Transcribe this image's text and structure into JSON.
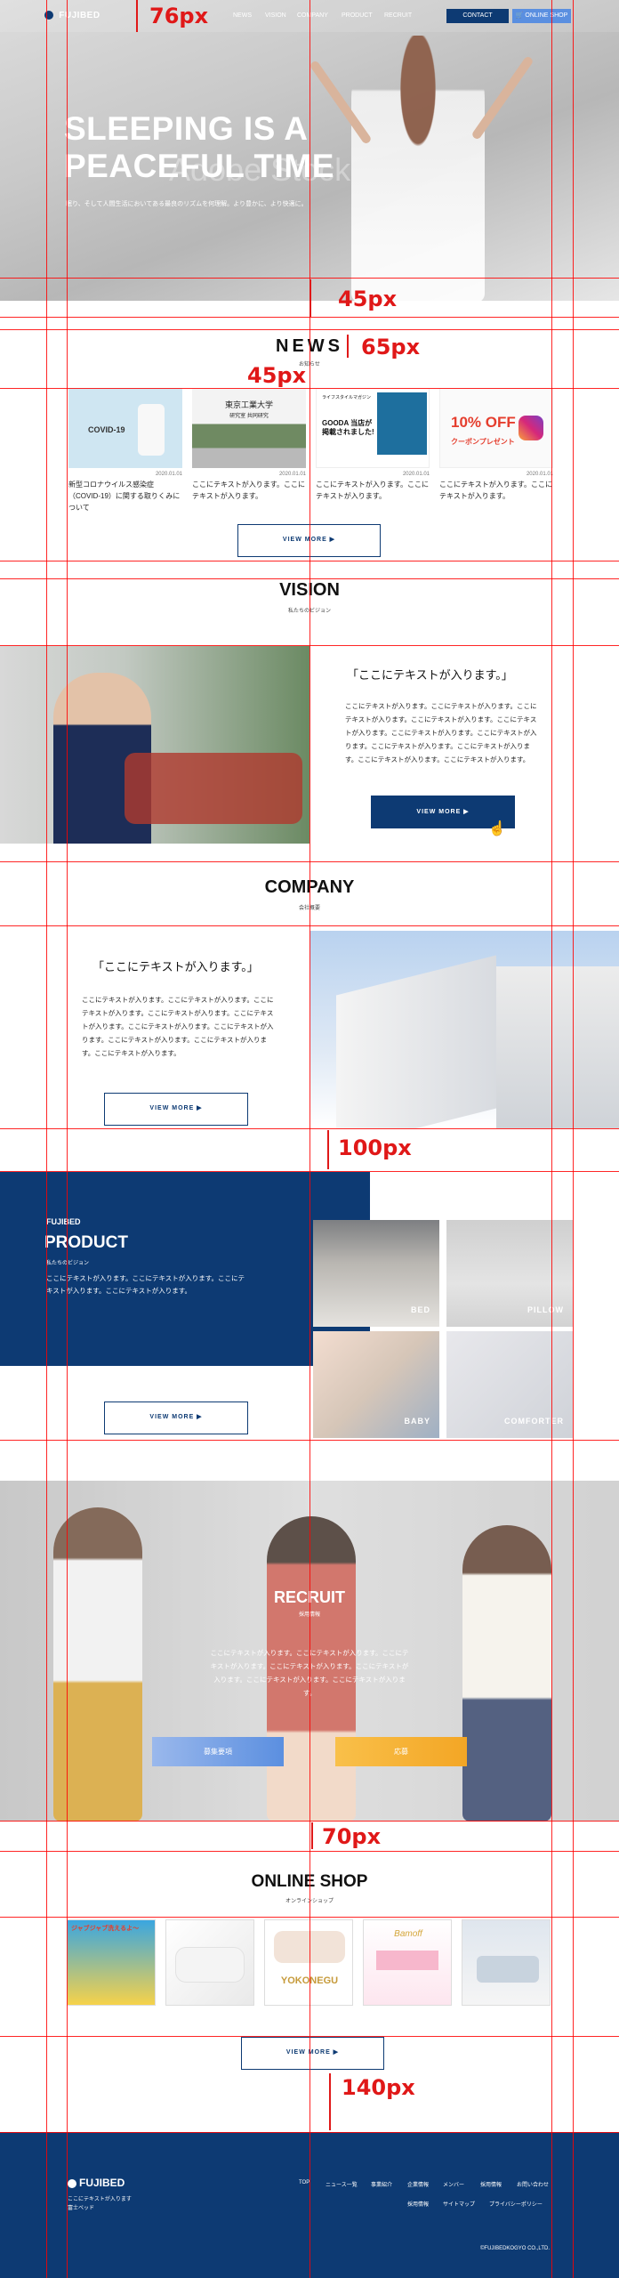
{
  "header": {
    "logo": "FUJIBED",
    "nav": [
      "NEWS",
      "VISION",
      "COMPANY",
      "PRODUCT",
      "RECRUIT"
    ],
    "contact_label": "CONTACT",
    "shop_label": "ONLINE SHOP"
  },
  "hero": {
    "title_line1": "SLEEPING IS A",
    "title_line2": "PEACEFUL TIME",
    "subtitle": "眠り、そして人間生活においてある最良のリズムを何理解。より豊かに、より快適に。",
    "watermark": "Adobe Stock"
  },
  "annotations": {
    "m76": "76px",
    "m45a": "45px",
    "m65": "65px",
    "m45b": "45px",
    "m100": "100px",
    "m70": "70px",
    "m140": "140px"
  },
  "news": {
    "title": "NEWS",
    "subtitle": "お知らせ",
    "cards": [
      {
        "img_text": "COVID-19",
        "date": "2020.01.01",
        "text": "新型コロナウイルス感染症（COVID-19）に関する取りくみについて"
      },
      {
        "img_text": "東京工業大学",
        "img_sub": "研究室 共同研究",
        "date": "2020.01.01",
        "text": "ここにテキストが入ります。ここにテキストが入ります。"
      },
      {
        "img_text": "ライフスタイルマガジン",
        "img_sub": "GOODA 当店が掲載されました!",
        "date": "2020.01.01",
        "text": "ここにテキストが入ります。ここにテキストが入ります。"
      },
      {
        "img_text": "10% OFF",
        "img_sub": "クーポンプレゼント",
        "date": "2020.01.01",
        "text": "ここにテキストが入ります。ここにテキストが入ります。"
      }
    ],
    "more": "VIEW MORE ▶"
  },
  "vision": {
    "title": "VISION",
    "subtitle": "私たちのビジョン",
    "quote": "「ここにテキストが入ります。」",
    "body": "ここにテキストが入ります。ここにテキストが入ります。ここにテキストが入ります。ここにテキストが入ります。ここにテキストが入ります。ここにテキストが入ります。ここにテキストが入ります。ここにテキストが入ります。ここにテキストが入ります。ここにテキストが入ります。ここにテキストが入ります。",
    "more": "VIEW MORE ▶"
  },
  "company": {
    "title": "COMPANY",
    "subtitle": "会社概要",
    "quote": "「ここにテキストが入ります。」",
    "body": "ここにテキストが入ります。ここにテキストが入ります。ここにテキストが入ります。ここにテキストが入ります。ここにテキストが入ります。ここにテキストが入ります。ここにテキストが入ります。ここにテキストが入ります。ここにテキストが入ります。ここにテキストが入ります。",
    "more": "VIEW MORE ▶"
  },
  "product": {
    "logo": "FUJIBED",
    "title": "PRODUCT",
    "subtitle": "私たちのビジョン",
    "body": "ここにテキストが入ります。ここにテキストが入ります。ここにテキストが入ります。ここにテキストが入ります。",
    "tiles": [
      "BED",
      "PILLOW",
      "BABY",
      "COMFORTER"
    ],
    "more": "VIEW MORE ▶"
  },
  "recruit": {
    "title": "RECRUIT",
    "subtitle": "採用情報",
    "body": "ここにテキストが入ります。ここにテキストが入ります。ここにテキストが入ります。ここにテキストが入ります。ここにテキストが入ります。ここにテキストが入ります。ここにテキストが入ります。",
    "btn_left": "募集要項",
    "btn_right": "応募"
  },
  "shop": {
    "title": "ONLINE SHOP",
    "subtitle": "オンラインショップ",
    "items": [
      "ジャブジャブ洗えるよ～",
      "",
      "YOKONEGU",
      "Bamoff",
      ""
    ],
    "more": "VIEW MORE ▶"
  },
  "footer": {
    "logo": "FUJIBED",
    "tagline": "ここにテキストが入ります",
    "tagline2": "富士ベッド",
    "links_row1": [
      "TOP",
      "ニュース一覧",
      "事業紹介",
      "企業情報",
      "メンバー",
      "採用情報",
      "お問い合わせ"
    ],
    "links_row2": [
      "採用情報",
      "サイトマップ",
      "プライバシーポリシー"
    ],
    "copyright": "©FUJIBEDKOGYO CO.,LTD."
  },
  "colors": {
    "navy": "#0d3a73",
    "blue": "#5a8fe0",
    "orange": "#f6b23a",
    "guide_red": "#ff0000"
  }
}
